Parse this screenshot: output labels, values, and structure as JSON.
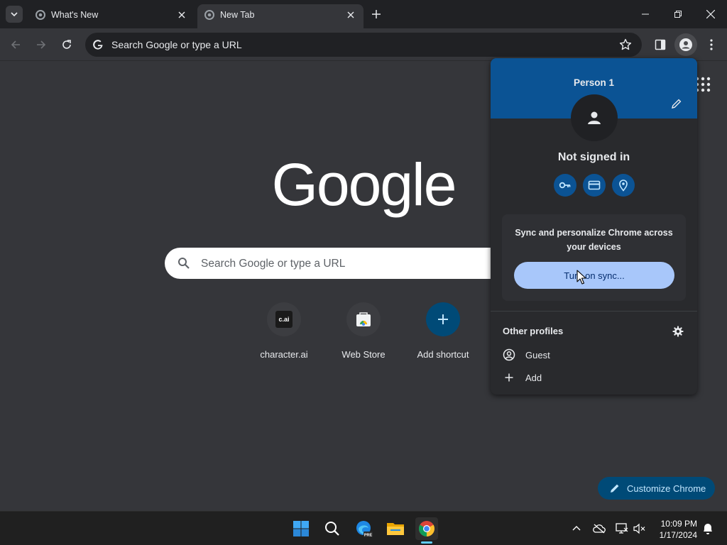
{
  "tabs": [
    {
      "title": "What's New",
      "active": false
    },
    {
      "title": "New Tab",
      "active": true
    }
  ],
  "omnibox": {
    "text": "Search Google or type a URL"
  },
  "ntp": {
    "logo_text": "Google",
    "search_placeholder": "Search Google or type a URL",
    "shortcuts": [
      {
        "label": "character.ai",
        "icon_text": "c.ai",
        "icon": "character-ai-icon"
      },
      {
        "label": "Web Store",
        "icon": "web-store-icon"
      },
      {
        "label": "Add shortcut",
        "icon": "plus-icon"
      }
    ],
    "customize_label": "Customize Chrome"
  },
  "profile_menu": {
    "name": "Person 1",
    "status": "Not signed in",
    "quick_icons": [
      "key-icon",
      "credit-card-icon",
      "location-pin-icon"
    ],
    "sync_text": "Sync and personalize Chrome across your devices",
    "sync_button": "Turn on sync...",
    "other_profiles_label": "Other profiles",
    "rows": [
      {
        "label": "Guest",
        "icon": "guest-icon"
      },
      {
        "label": "Add",
        "icon": "plus-icon"
      }
    ]
  },
  "taskbar": {
    "time": "10:09 PM",
    "date": "1/17/2024"
  },
  "colors": {
    "page_bg": "#35363a",
    "tabstrip_bg": "#202124",
    "accent_blue": "#0b5394",
    "sync_button_bg": "#a8c7fa",
    "customize_bg": "#004a77"
  }
}
